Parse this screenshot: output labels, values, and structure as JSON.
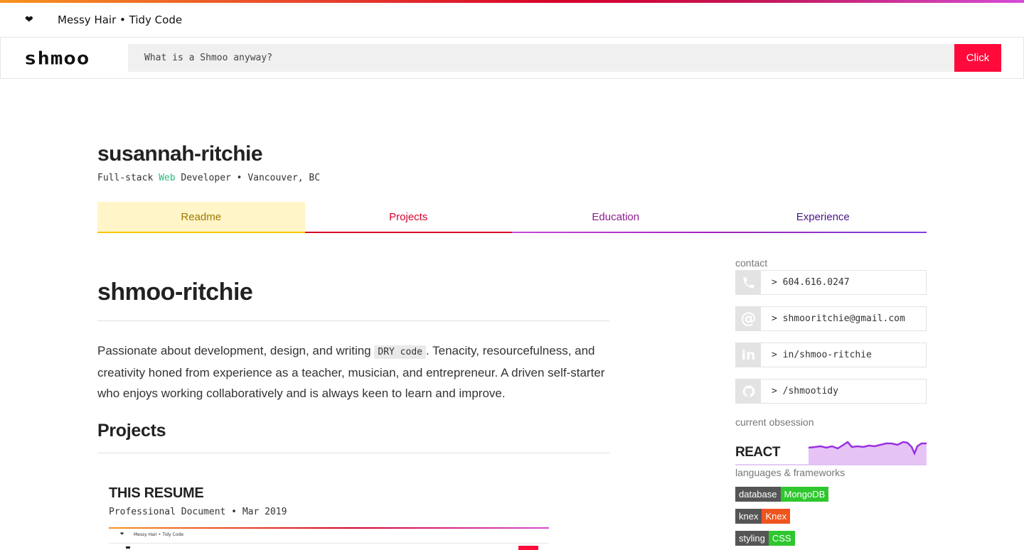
{
  "header": {
    "tagline": "Messy Hair • Tidy Code",
    "logo": "shmoo",
    "search_placeholder": "What is a Shmoo anyway?",
    "button_label": "Click"
  },
  "profile": {
    "name": "susannah-ritchie",
    "subtitle_pre": "Full-stack ",
    "subtitle_web": "Web",
    "subtitle_post": " Developer • Vancouver, BC"
  },
  "tabs": [
    {
      "label": "Readme"
    },
    {
      "label": "Projects"
    },
    {
      "label": "Education"
    },
    {
      "label": "Experience"
    }
  ],
  "readme": {
    "heading": "shmoo-ritchie",
    "intro_before": "Passionate about development, design, and writing ",
    "intro_code": "DRY code",
    "intro_after": ". Tenacity, resourcefulness, and creativity honed from experience as a teacher, musician, and entrepreneur. A driven self-starter who enjoys working collaboratively and is always keen to learn and improve.",
    "projects_heading": "Projects",
    "project": {
      "title": "THIS RESUME",
      "subtitle": "Professional Document • Mar 2019",
      "thumb_tagline": "Messy Hair • Tidy Code"
    }
  },
  "sidebar": {
    "contact_label": "contact",
    "contacts": [
      {
        "icon": "phone-icon",
        "text": "> 604.616.0247"
      },
      {
        "icon": "at-icon",
        "text": "> shmooritchie@gmail.com"
      },
      {
        "icon": "linkedin-icon",
        "text": "> in/shmoo-ritchie"
      },
      {
        "icon": "github-icon",
        "text": "> /shmootidy"
      }
    ],
    "obsession_label": "current obsession",
    "obsession": "REACT",
    "languages_label": "languages & frameworks",
    "badges": [
      {
        "key": "database",
        "value": "MongoDB",
        "color": "#2ec72e"
      },
      {
        "key": "knex",
        "value": "Knex",
        "color": "#f0541e"
      },
      {
        "key": "styling",
        "value": "CSS",
        "color": "#2ec72e"
      }
    ]
  },
  "colors": {
    "accent_red": "#ff0a3a",
    "web_green": "#2ebd7d",
    "spark_purple": "#9b30e0"
  }
}
